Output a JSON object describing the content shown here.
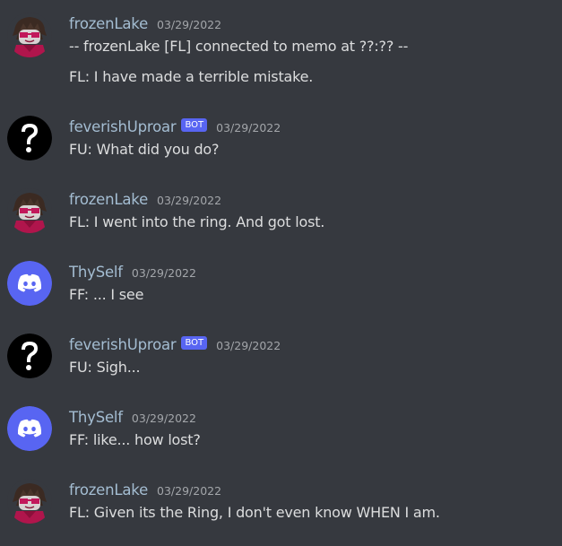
{
  "messages": [
    {
      "author": "frozenLake",
      "avatar": "troll-character-avatar",
      "bot": "",
      "timestamp": "03/29/2022",
      "lines": [
        "-- frozenLake [FL] connected to memo at ??:?? --",
        "FL: I have made a terrible mistake."
      ]
    },
    {
      "author": "feverishUproar",
      "avatar": "question-mark-avatar",
      "bot": "BOT",
      "timestamp": "03/29/2022",
      "lines": [
        "FU: What did you do?"
      ]
    },
    {
      "author": "frozenLake",
      "avatar": "troll-character-avatar",
      "bot": "",
      "timestamp": "03/29/2022",
      "lines": [
        "FL: I went into the ring. And got lost."
      ]
    },
    {
      "author": "ThySelf",
      "avatar": "discord-logo-avatar",
      "bot": "",
      "timestamp": "03/29/2022",
      "lines": [
        "FF: ... I see"
      ]
    },
    {
      "author": "feverishUproar",
      "avatar": "question-mark-avatar",
      "bot": "BOT",
      "timestamp": "03/29/2022",
      "lines": [
        "FU: Sigh..."
      ]
    },
    {
      "author": "ThySelf",
      "avatar": "discord-logo-avatar",
      "bot": "",
      "timestamp": "03/29/2022",
      "lines": [
        "FF: like... how lost?"
      ]
    },
    {
      "author": "frozenLake",
      "avatar": "troll-character-avatar",
      "bot": "",
      "timestamp": "03/29/2022",
      "lines": [
        "FL: Given its the Ring, I don't even know WHEN I am."
      ]
    }
  ],
  "colors": {
    "background": "#36393f",
    "username": "#a4bdd2",
    "timestamp": "#a3a6aa",
    "text": "#dcddde",
    "bot_tag": "#5865f2",
    "discord_blurple": "#5865f2"
  }
}
